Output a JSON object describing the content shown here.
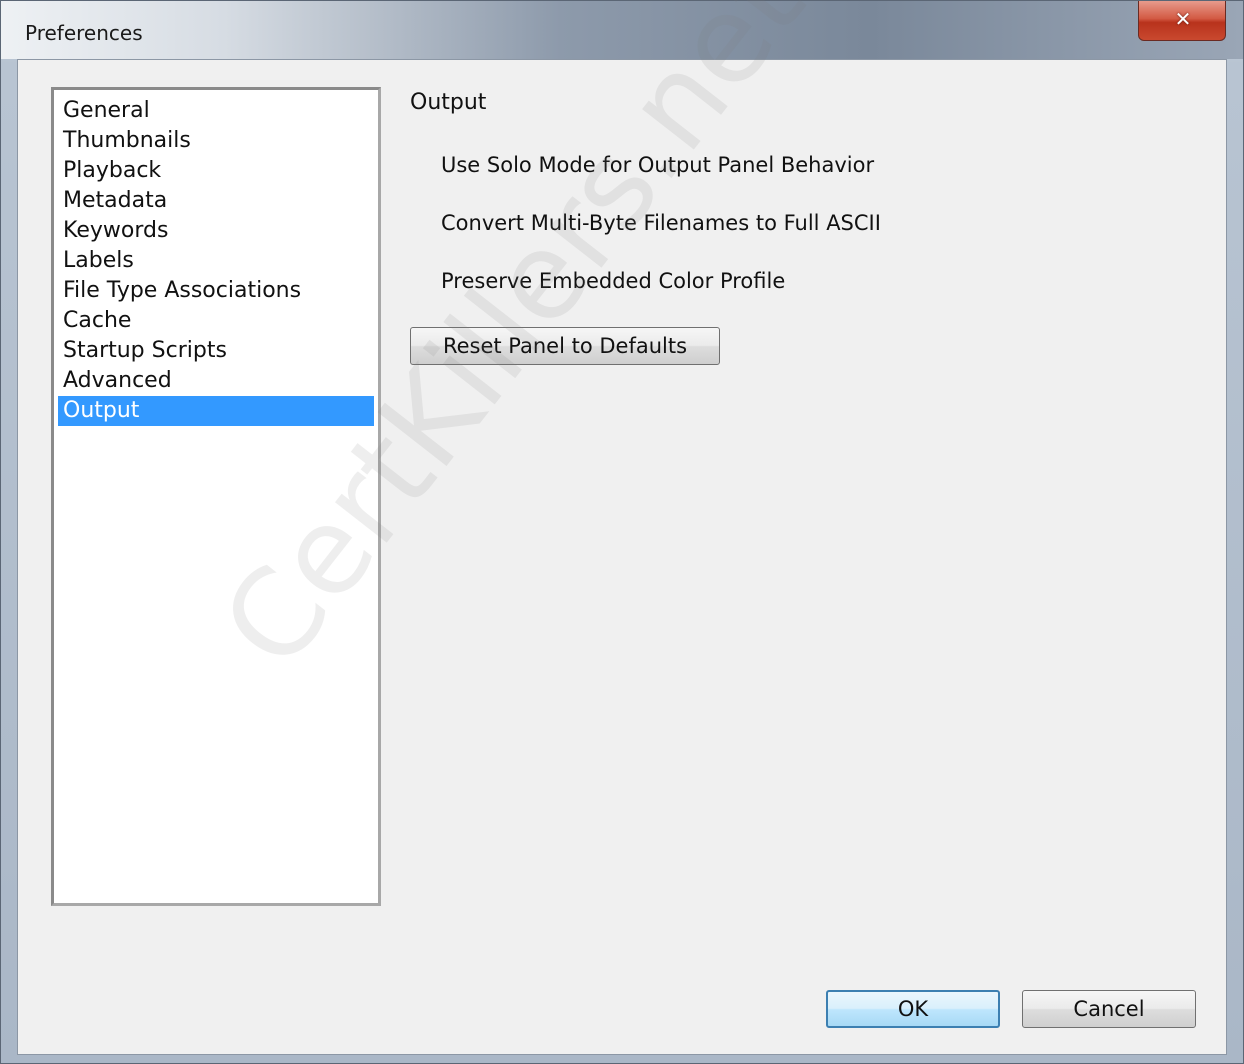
{
  "window": {
    "title": "Preferences",
    "close_glyph": "✕"
  },
  "sidebar": {
    "items": [
      {
        "label": "General",
        "selected": false
      },
      {
        "label": "Thumbnails",
        "selected": false
      },
      {
        "label": "Playback",
        "selected": false
      },
      {
        "label": "Metadata",
        "selected": false
      },
      {
        "label": "Keywords",
        "selected": false
      },
      {
        "label": "Labels",
        "selected": false
      },
      {
        "label": "File Type Associations",
        "selected": false
      },
      {
        "label": "Cache",
        "selected": false
      },
      {
        "label": "Startup Scripts",
        "selected": false
      },
      {
        "label": "Advanced",
        "selected": false
      },
      {
        "label": "Output",
        "selected": true
      }
    ]
  },
  "panel": {
    "title": "Output",
    "options": [
      {
        "label": "Use Solo Mode for Output Panel Behavior",
        "checked": false
      },
      {
        "label": "Convert Multi-Byte Filenames to Full ASCII",
        "checked": false
      },
      {
        "label": "Preserve Embedded Color Profile",
        "checked": false
      }
    ],
    "reset_label": "Reset Panel to Defaults"
  },
  "buttons": {
    "ok_label": "OK",
    "cancel_label": "Cancel"
  },
  "watermark": {
    "text": "CertKillers.net"
  },
  "colors": {
    "selection": "#3399ff",
    "default_button_border": "#3c7fb1"
  }
}
